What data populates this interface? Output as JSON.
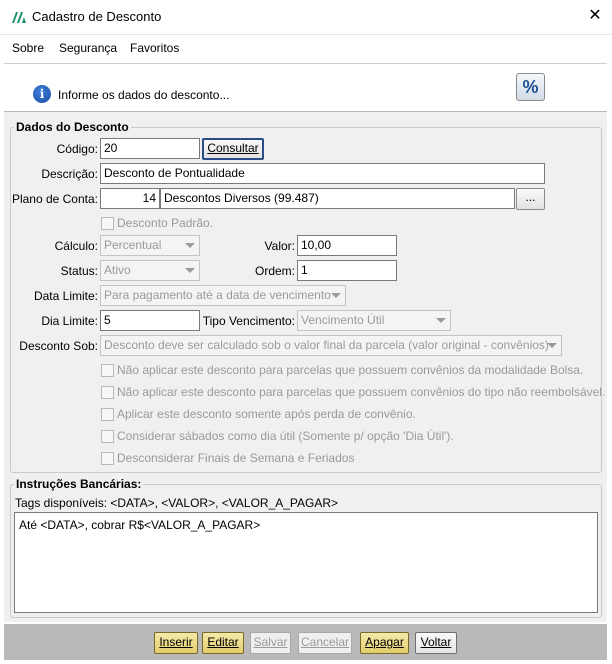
{
  "window": {
    "title": "Cadastro de Desconto",
    "close_glyph": "✕"
  },
  "menu": {
    "items": [
      "Sobre",
      "Segurança",
      "Favoritos"
    ]
  },
  "header": {
    "message": "Informe os dados do desconto...",
    "info_glyph": "i",
    "percent_glyph": "%"
  },
  "dados": {
    "group_title": "Dados do Desconto",
    "codigo": {
      "label": "Código:",
      "value": "20",
      "button": "Consultar"
    },
    "descricao": {
      "label": "Descrição:",
      "value": "Desconto de Pontualidade"
    },
    "plano": {
      "label": "Plano de Conta:",
      "code": "14",
      "name": "Descontos Diversos (99.487)",
      "browse": "..."
    },
    "padrao": {
      "label": "Desconto Padrão."
    },
    "calculo": {
      "label": "Cálculo:",
      "value": "Percentual"
    },
    "valor": {
      "label": "Valor:",
      "value": "10,00"
    },
    "status": {
      "label": "Status:",
      "value": "Ativo"
    },
    "ordem": {
      "label": "Ordem:",
      "value": "1"
    },
    "data_limite": {
      "label": "Data Limite:",
      "value": "Para pagamento até a data de vencimento"
    },
    "dia_limite": {
      "label": "Dia Limite:",
      "value": "5"
    },
    "tipo_venc": {
      "label": "Tipo Vencimento:",
      "value": "Vencimento Útil"
    },
    "desconto_sob": {
      "label": "Desconto Sob:",
      "value": "Desconto deve ser calculado sob o valor final da parcela (valor original - convênios)"
    },
    "checks": [
      "Não aplicar este desconto para parcelas que possuem convênios da modalidade Bolsa.",
      "Não aplicar este desconto para parcelas que possuem convênios do tipo não reembolsável.",
      "Aplicar este desconto somente após perda de convênio.",
      "Considerar sábados como dia útil (Somente p/ opção 'Dia Útil').",
      "Desconsiderar Finais de Semana e Feriados"
    ]
  },
  "instrucoes": {
    "group_title": "Instruções Bancárias:",
    "tags": "Tags disponíveis: <DATA>, <VALOR>, <VALOR_A_PAGAR>",
    "text": "Até <DATA>, cobrar R$<VALOR_A_PAGAR>"
  },
  "footer": {
    "inserir": "Inserir",
    "editar": "Editar",
    "salvar": "Salvar",
    "cancelar": "Cancelar",
    "apagar": "Apagar",
    "voltar": "Voltar"
  }
}
